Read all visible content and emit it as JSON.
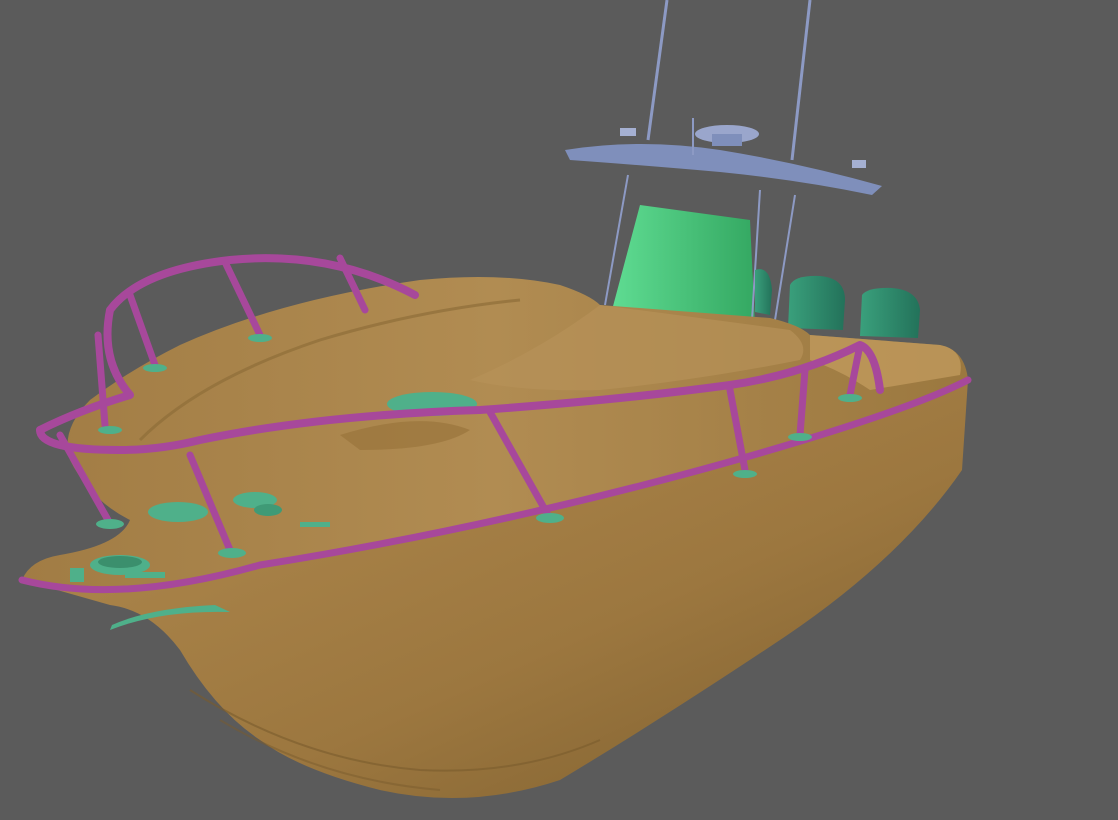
{
  "scene": {
    "background_color": "#5b5b5b",
    "colors": {
      "hull": "#b08a4e",
      "hull_shadow": "#8e6c37",
      "deck": "#a88349",
      "deck_highlight": "#c09a5c",
      "rail": "#a7489b",
      "rail_highlight": "#c96abe",
      "fittings": "#4fb08a",
      "console": "#43c47a",
      "t_top": "#7f8fbb",
      "antenna": "#8d9ac4",
      "engines": "#2f8f6e"
    }
  }
}
